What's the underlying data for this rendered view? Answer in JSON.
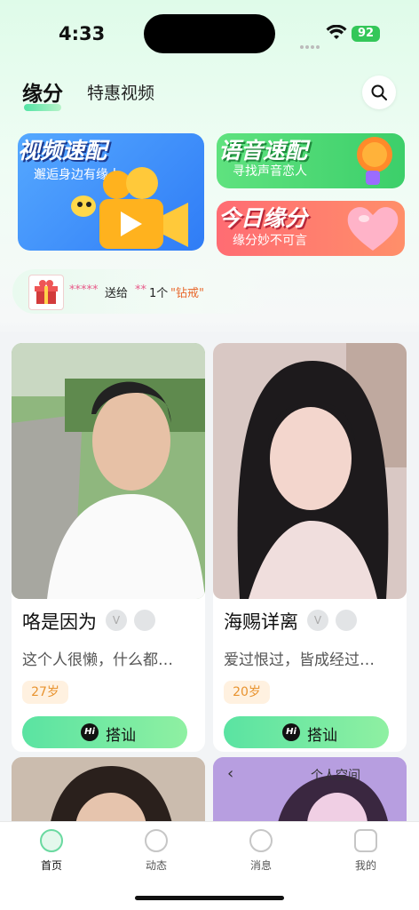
{
  "status_bar": {
    "time": "4:33",
    "battery": "92"
  },
  "tabs": {
    "active": "缘分",
    "second": "特惠视频"
  },
  "banners": {
    "video": {
      "title": "视频速配",
      "subtitle": "邂逅身边有缘人"
    },
    "voice": {
      "title": "语音速配",
      "subtitle": "寻找声音恋人"
    },
    "daily": {
      "title": "今日缘分",
      "subtitle": "缘分妙不可言"
    }
  },
  "gift_ticker": {
    "sender": "*****",
    "action": "送给",
    "receiver": "**",
    "count": "1个",
    "gift": "\"钻戒\""
  },
  "cards": [
    {
      "name": "咯是因为",
      "bio": "这个人很懒，什么都…",
      "age": "27岁",
      "button": "搭讪"
    },
    {
      "name": "海赐详离",
      "bio": "爱过恨过，皆成经过…",
      "age": "20岁",
      "button": "搭讪"
    }
  ],
  "partial_card": {
    "label": "个人空间"
  },
  "nav": [
    {
      "label": "首页",
      "icon": "home-icon"
    },
    {
      "label": "动态",
      "icon": "moments-icon"
    },
    {
      "label": "消息",
      "icon": "message-icon"
    },
    {
      "label": "我的",
      "icon": "profile-icon"
    }
  ],
  "colors": {
    "accent": "#5ae3a2",
    "age_text": "#e8932f",
    "gift_text": "#e86a2f"
  }
}
